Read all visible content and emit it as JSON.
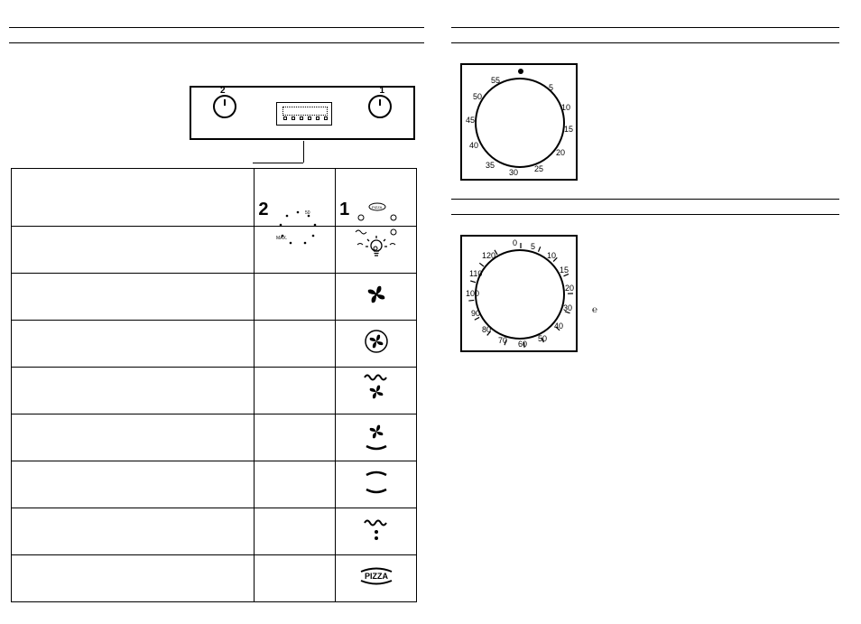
{
  "left": {
    "heading_rule_pair": true,
    "panel": {
      "knob_labels": {
        "left": "2",
        "right": "1"
      }
    },
    "table": {
      "header": {
        "col2_label": "2",
        "col1_label": "1"
      },
      "rows": [
        {
          "col1_label": "",
          "col2_label": "",
          "icon": "lamp"
        },
        {
          "col1_label": "",
          "col2_label": "",
          "icon": "fan-4blade"
        },
        {
          "col1_label": "",
          "col2_label": "",
          "icon": "fan-circle"
        },
        {
          "col1_label": "",
          "col2_label": "",
          "icon": "grill-and-fan"
        },
        {
          "col1_label": "",
          "col2_label": "",
          "icon": "fan-bottom-heat"
        },
        {
          "col1_label": "",
          "col2_label": "",
          "icon": "top-bottom-heat"
        },
        {
          "col1_label": "",
          "col2_label": "",
          "icon": "grill-dot"
        },
        {
          "col1_label": "",
          "col2_label": "",
          "icon": "pizza"
        }
      ]
    }
  },
  "right": {
    "dial1": {
      "numbers": [
        "5",
        "10",
        "15",
        "20",
        "25",
        "30",
        "35",
        "40",
        "45",
        "50",
        "55"
      ],
      "top_marker": "dot"
    },
    "dial2": {
      "numbers": [
        "0",
        "5",
        "10",
        "15",
        "20",
        "30",
        "40",
        "50",
        "60",
        "70",
        "80",
        "90",
        "100",
        "110",
        "120"
      ]
    },
    "note_glyph": "℮"
  }
}
